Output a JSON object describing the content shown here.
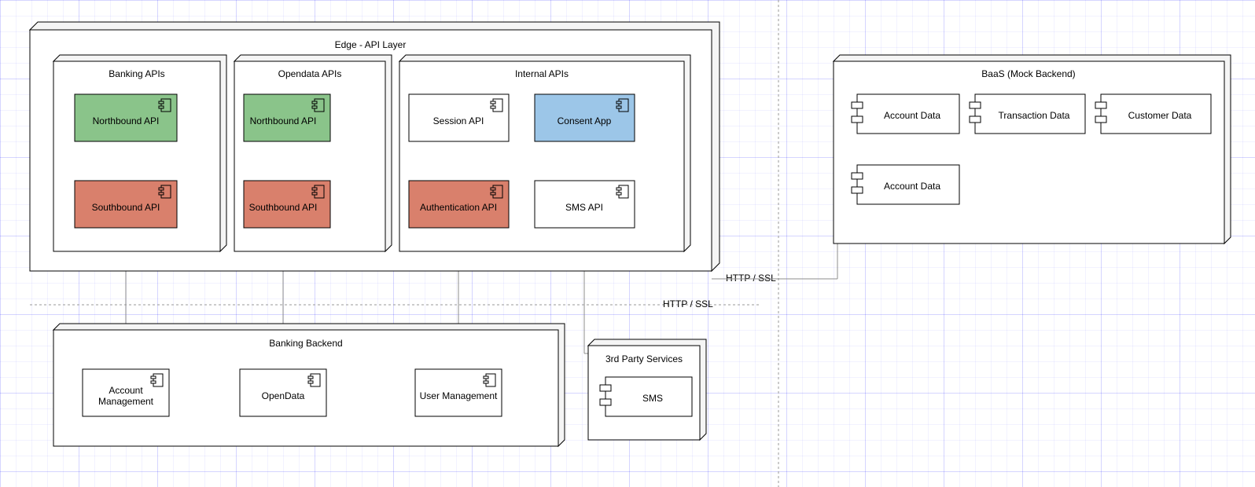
{
  "diagram": {
    "edge_layer": {
      "title": "Edge - API Layer",
      "banking_apis": {
        "title": "Banking APIs",
        "northbound": "Northbound API",
        "southbound": "Southbound API"
      },
      "opendata_apis": {
        "title": "Opendata APIs",
        "northbound": "Northbound API",
        "southbound": "Southbound API"
      },
      "internal_apis": {
        "title": "Internal APIs",
        "session": "Session API",
        "consent": "Consent App",
        "authentication": "Authentication API",
        "sms": "SMS API"
      }
    },
    "banking_backend": {
      "title": "Banking Backend",
      "account_mgmt": "Account Management",
      "opendata": "OpenData",
      "user_mgmt": "User Management"
    },
    "third_party": {
      "title": "3rd Party Services",
      "sms": "SMS"
    },
    "baas": {
      "title": "BaaS (Mock Backend)",
      "account_data": "Account Data",
      "transaction_data": "Transaction Data",
      "customer_data": "Customer Data",
      "account_data_2": "Account Data"
    },
    "connections": {
      "http_ssl_left": "HTTP / SSL",
      "http_ssl_right": "HTTP / SSL"
    },
    "colors": {
      "green": "#8ac48a",
      "red": "#d9806c",
      "blue": "#9cc6e8",
      "white": "#ffffff",
      "stroke": "#000000",
      "line": "#8c8c8c",
      "dash": "#999999"
    }
  }
}
